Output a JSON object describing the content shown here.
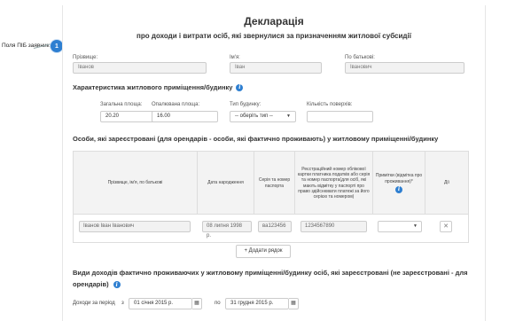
{
  "callout": {
    "label": "Поля ПІБ заявника",
    "number": "1"
  },
  "header": {
    "title": "Декларація",
    "subtitle": "про доходи і витрати осіб, які звернулися за призначенням житлової субсидії"
  },
  "applicant": {
    "surname_label": "Прізвище:",
    "surname_value": "Іванов",
    "name_label": "Ім'я:",
    "name_value": "Іван",
    "patronymic_label": "По батькові:",
    "patronymic_value": "Іванович"
  },
  "housing": {
    "heading": "Характеристика житлового приміщення/будинку",
    "total_area_label": "Загальна площа:",
    "total_area_value": "20.20",
    "heated_area_label": "Опалювана площа:",
    "heated_area_value": "16.00",
    "building_type_label": "Тип будинку:",
    "building_type_value": "-- оберіть тип --",
    "floors_label": "Кількість поверхів:",
    "floors_value": ""
  },
  "persons": {
    "heading": "Особи, які зареєстровані (для орендарів - особи, які фактично проживають) у житловому приміщенні/будинку",
    "columns": [
      "Прізвище, ім'я, по батькові",
      "Дата народження",
      "Серія та номер паспорта",
      "Реєстраційний номер облікової картки платника податків або серія та номер паспорта(для осіб, які мають відмітку у паспорті про право здійснювати платежі за його серією та номером)",
      "Примітки (відмітка про проживання)*",
      "Дії"
    ],
    "row": {
      "full_name": "Іванов Іван Іванович",
      "birth_date": "08 липня 1998 р.",
      "passport": "ва123456",
      "tax_number": "1234567890",
      "note": ""
    },
    "add_row_label": "+ Додати рядок",
    "delete_glyph": "✕"
  },
  "income": {
    "heading": "Види доходів фактично проживаючих у житловому приміщенні/будинку осіб, які зареєстровані (не зареєстровані - для орендарів)",
    "period_label": "Доходи за період",
    "from_label": "з",
    "from_value": "01 січня 2015 р.",
    "to_label": "по",
    "to_value": "31 грудня 2015 р."
  },
  "icons": {
    "info": "info-icon",
    "calendar": "calendar-icon",
    "caret": "caret-down-icon"
  },
  "colors": {
    "accent": "#2e7fd1",
    "field_bg": "#f2f2f2",
    "border": "#cccccc"
  }
}
